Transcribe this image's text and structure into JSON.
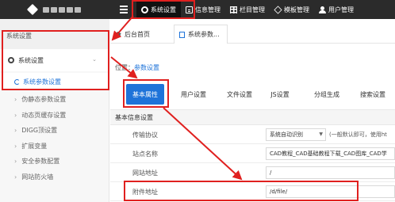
{
  "topbar": {
    "nav": [
      {
        "label": "系统设置",
        "icon": "gear-icon",
        "active": true
      },
      {
        "label": "信息管理",
        "icon": "document-icon",
        "active": false
      },
      {
        "label": "栏目管理",
        "icon": "grid-icon",
        "active": false
      },
      {
        "label": "模板管理",
        "icon": "layers-icon",
        "active": false
      },
      {
        "label": "用户管理",
        "icon": "user-icon",
        "active": false
      }
    ]
  },
  "sidebar": {
    "title": "系统设置",
    "group": "系统设置",
    "active_item": "系统参数设置",
    "items": [
      "伪静态参数设置",
      "动态页缓存设置",
      "DIGG顶设置",
      "扩展变量",
      "安全参数配置",
      "网站防火墙"
    ]
  },
  "content_tabs": {
    "home": "后台首页",
    "current": "系统参数..."
  },
  "breadcrumb": {
    "prefix": "位置：",
    "link": "参数设置"
  },
  "settings_tabs": [
    "基本属性",
    "用户设置",
    "文件设置",
    "JS设置",
    "分组生成",
    "搜索设置"
  ],
  "section": {
    "title": "基本信息设置"
  },
  "fields": [
    {
      "label": "传输协议",
      "value": "系统自动识别",
      "hint": "(一般默认即可，使用ht"
    },
    {
      "label": "站点名称",
      "value": "CAD教程_CAD基础教程下载_CAD图库_CAD学"
    },
    {
      "label": "网站地址",
      "value": "/"
    },
    {
      "label": "附件地址",
      "value": "/d/file/"
    }
  ],
  "colors": {
    "topbar": "#2b2b2b",
    "accent": "#1e73d9",
    "highlight": "#e0201f"
  }
}
